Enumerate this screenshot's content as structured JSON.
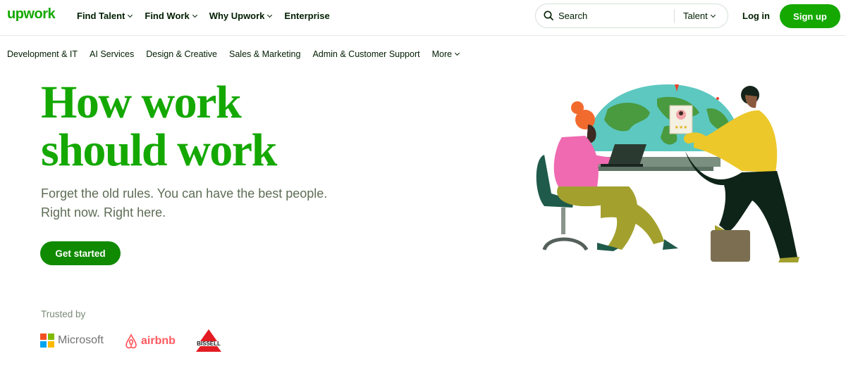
{
  "logo": "upwork",
  "nav": {
    "find_talent": "Find Talent",
    "find_work": "Find Work",
    "why_upwork": "Why Upwork",
    "enterprise": "Enterprise"
  },
  "search": {
    "label": "Search",
    "type": "Talent"
  },
  "auth": {
    "login": "Log in",
    "signup": "Sign up"
  },
  "categories": {
    "c0": "Development & IT",
    "c1": "AI Services",
    "c2": "Design & Creative",
    "c3": "Sales & Marketing",
    "c4": "Admin & Customer Support",
    "more": "More"
  },
  "hero": {
    "title_line1": "How work",
    "title_line2": "should work",
    "sub_line1": "Forget the old rules. You can have the best people.",
    "sub_line2": "Right now. Right here.",
    "cta": "Get started"
  },
  "trusted": {
    "label": "Trusted by",
    "microsoft": "Microsoft",
    "airbnb": "airbnb",
    "bissell": "BISSELL"
  },
  "colors": {
    "brand_green": "#14a800",
    "cta_green": "#108a00"
  },
  "icons": [
    "search-icon",
    "chevron-down-icon",
    "microsoft-logo",
    "airbnb-logo",
    "bissell-logo"
  ]
}
